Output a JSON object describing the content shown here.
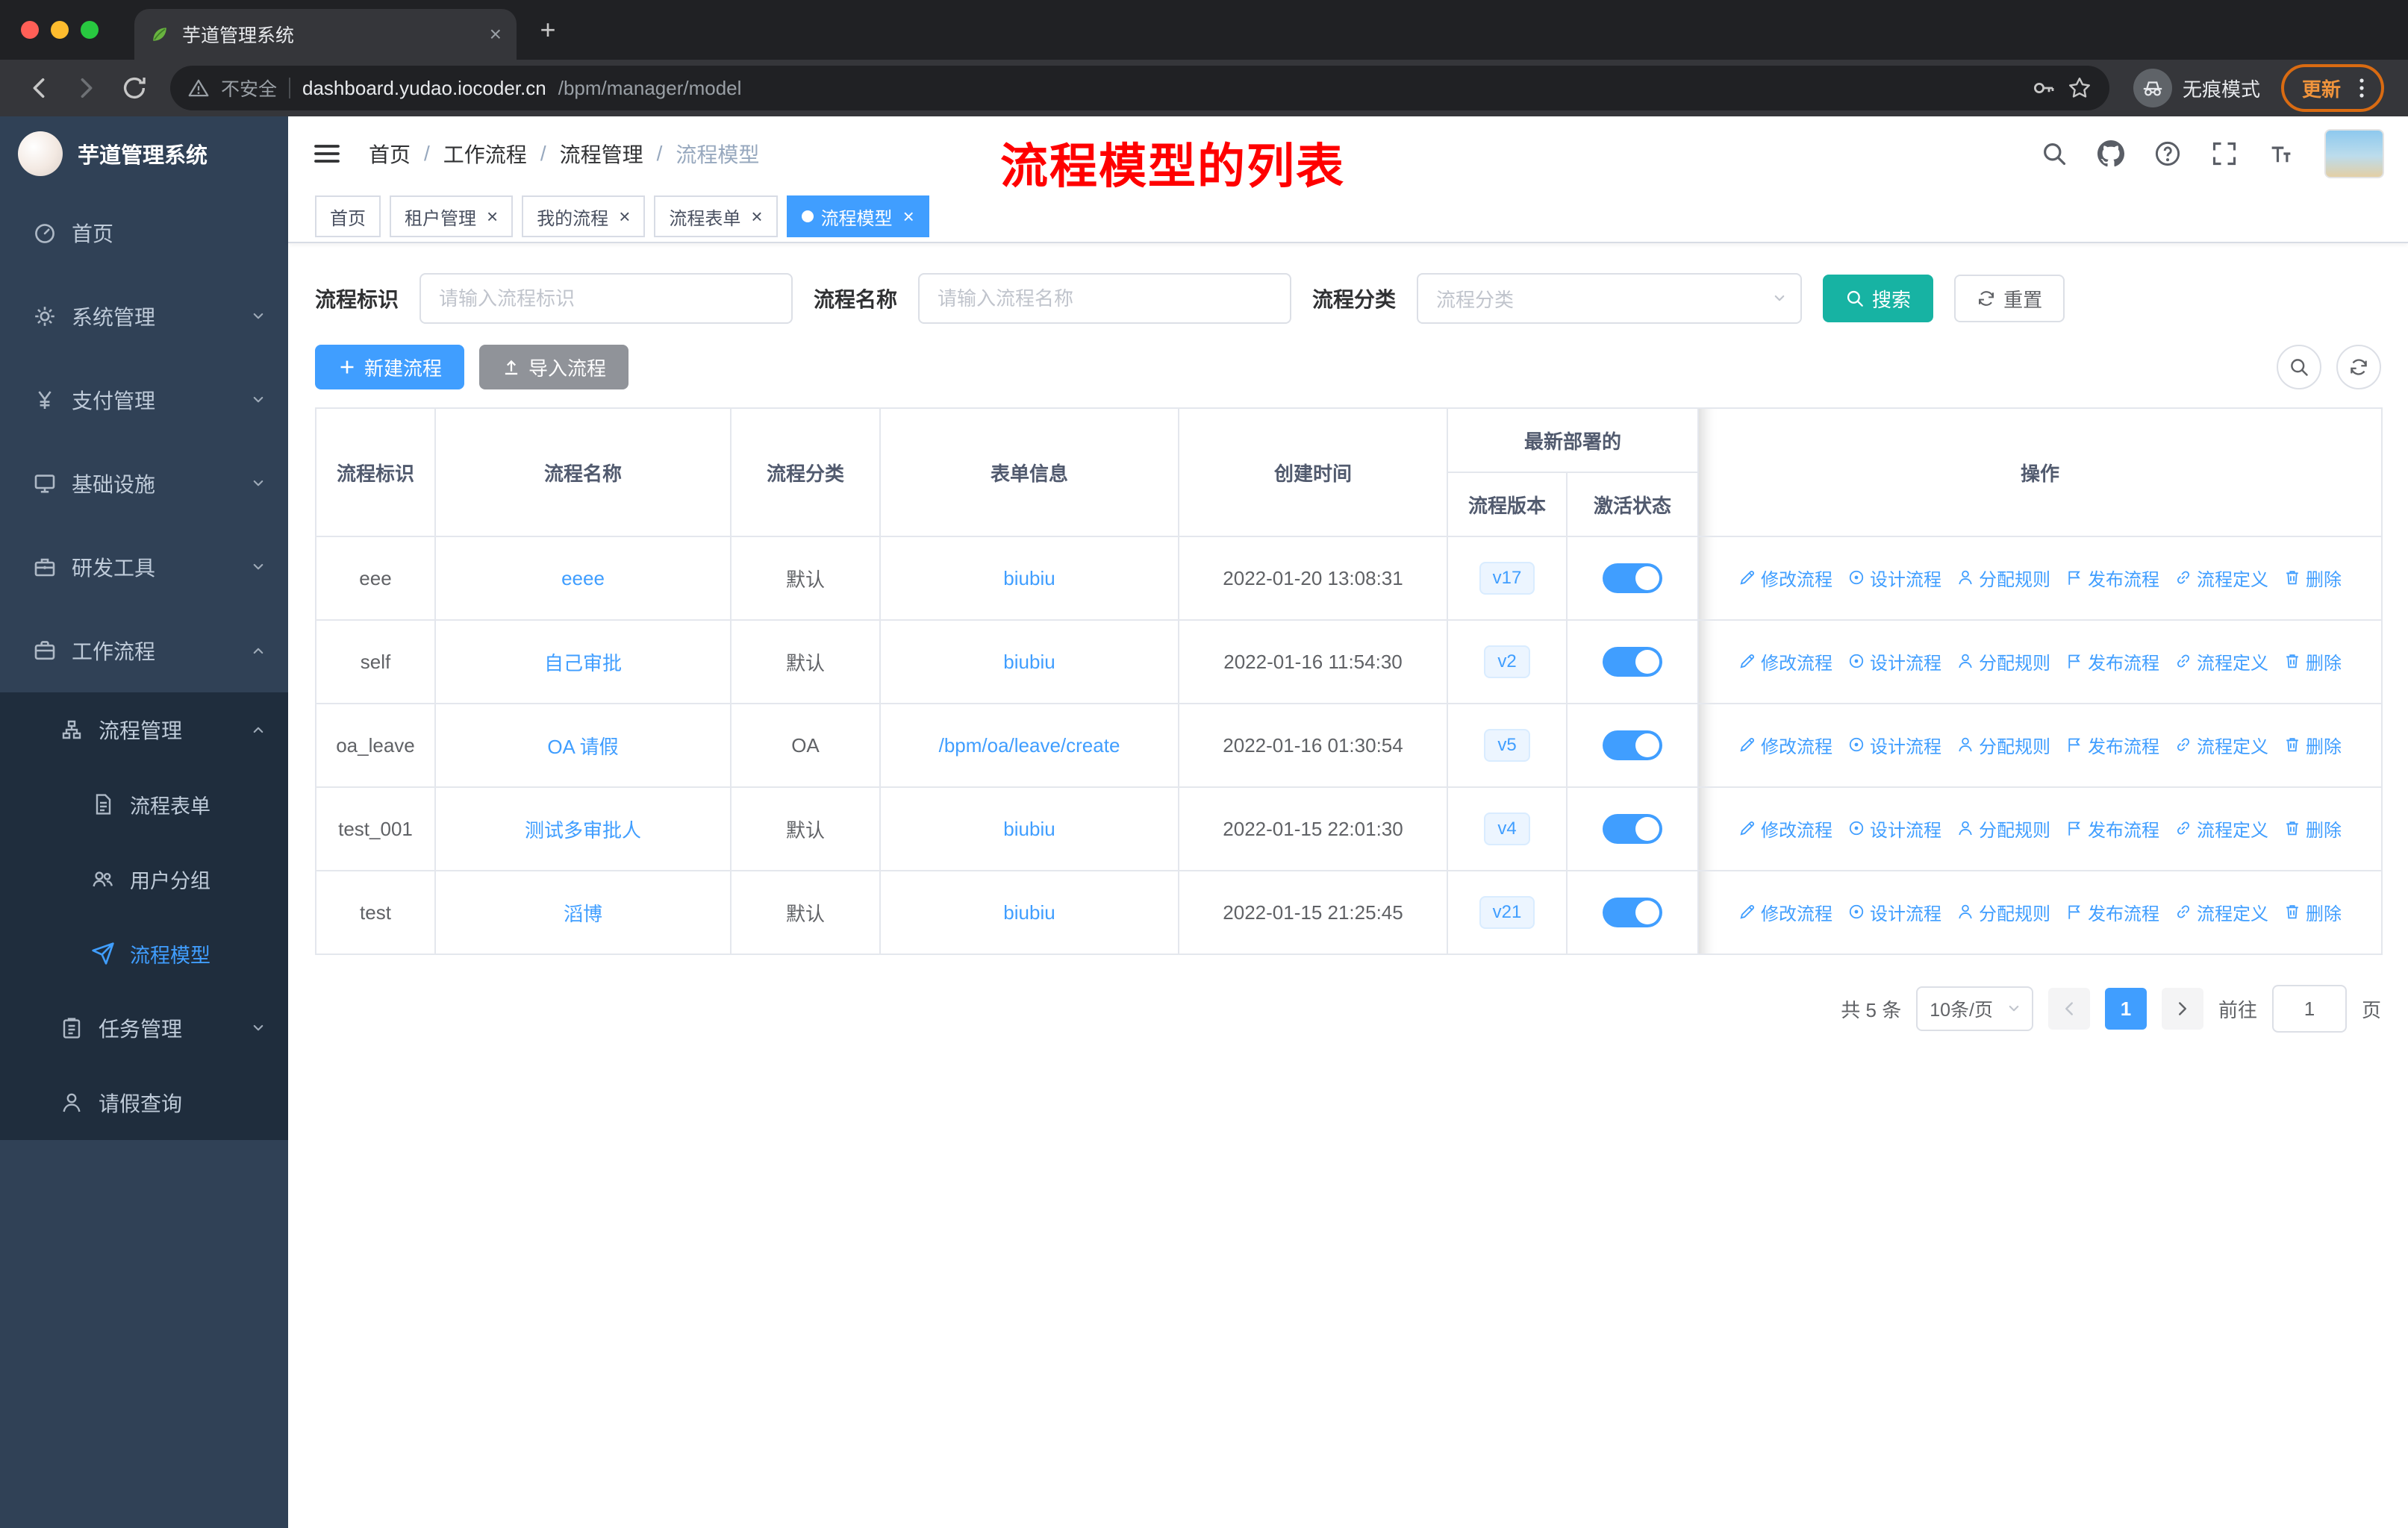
{
  "colors": {
    "accent": "#409eff",
    "search_button": "#17b3a3",
    "annotation": "#ff0000",
    "sidebar_bg": "#304156",
    "toggle_on": "#409eff"
  },
  "browser": {
    "tab_title": "芋道管理系统",
    "security_label": "不安全",
    "url_host": "dashboard.yudao.iocoder.cn",
    "url_path": "/bpm/manager/model",
    "incognito_label": "无痕模式",
    "update_label": "更新"
  },
  "sidebar": {
    "logo_text": "芋道管理系统",
    "items": {
      "home": "首页",
      "system": "系统管理",
      "payment": "支付管理",
      "infra": "基础设施",
      "devtools": "研发工具",
      "workflow": "工作流程",
      "process_mgmt": "流程管理",
      "process_form": "流程表单",
      "user_group": "用户分组",
      "process_model": "流程模型",
      "task_mgmt": "任务管理",
      "leave_query": "请假查询"
    }
  },
  "header": {
    "breadcrumb": [
      "首页",
      "工作流程",
      "流程管理",
      "流程模型"
    ],
    "annotation": "流程模型的列表"
  },
  "tags": [
    "首页",
    "租户管理",
    "我的流程",
    "流程表单",
    "流程模型"
  ],
  "filters": {
    "key_label": "流程标识",
    "key_placeholder": "请输入流程标识",
    "name_label": "流程名称",
    "name_placeholder": "请输入流程名称",
    "category_label": "流程分类",
    "category_placeholder": "流程分类",
    "search_label": "搜索",
    "reset_label": "重置"
  },
  "toolbar": {
    "create_label": "新建流程",
    "import_label": "导入流程"
  },
  "table": {
    "headers": {
      "key": "流程标识",
      "name": "流程名称",
      "category": "流程分类",
      "form": "表单信息",
      "created": "创建时间",
      "deploy_group": "最新部署的",
      "version": "流程版本",
      "status": "激活状态",
      "actions": "操作"
    },
    "actions": [
      "修改流程",
      "设计流程",
      "分配规则",
      "发布流程",
      "流程定义",
      "删除"
    ],
    "rows": [
      {
        "key": "eee",
        "name": "eeee",
        "category": "默认",
        "form": "biubiu",
        "created": "2022-01-20 13:08:31",
        "version": "v17"
      },
      {
        "key": "self",
        "name": "自己审批",
        "category": "默认",
        "form": "biubiu",
        "created": "2022-01-16 11:54:30",
        "version": "v2"
      },
      {
        "key": "oa_leave",
        "name": "OA 请假",
        "category": "OA",
        "form": "/bpm/oa/leave/create",
        "created": "2022-01-16 01:30:54",
        "version": "v5"
      },
      {
        "key": "test_001",
        "name": "测试多审批人",
        "category": "默认",
        "form": "biubiu",
        "created": "2022-01-15 22:01:30",
        "version": "v4"
      },
      {
        "key": "test",
        "name": "滔博",
        "category": "默认",
        "form": "biubiu",
        "created": "2022-01-15 21:25:45",
        "version": "v21"
      }
    ]
  },
  "pagination": {
    "total": "共 5 条",
    "page_size": "10条/页",
    "current_page": "1",
    "goto_label": "前往",
    "goto_value": "1",
    "page_unit": "页"
  }
}
